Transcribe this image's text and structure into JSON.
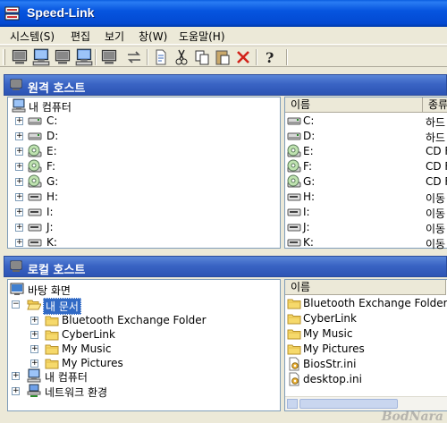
{
  "window": {
    "title": "Speed-Link"
  },
  "menu": [
    {
      "label": "시스템(S)"
    },
    {
      "label": "편집"
    },
    {
      "label": "보기"
    },
    {
      "label": "창(W)"
    },
    {
      "label": "도움말(H)"
    }
  ],
  "toolbar": {
    "buttons": [
      "connect-icon",
      "computer-icon",
      "computer-off-icon",
      "network-computer-icon",
      "disconnect-icon",
      "transfer-icon",
      "properties-icon",
      "cut-icon",
      "copy-icon",
      "paste-icon",
      "delete-icon",
      "help-icon"
    ]
  },
  "remote": {
    "header": "원격 호스트",
    "tree_root": "내 컴퓨터",
    "drives": [
      {
        "label": "C:",
        "kind": "hdd"
      },
      {
        "label": "D:",
        "kind": "hdd"
      },
      {
        "label": "E:",
        "kind": "cd"
      },
      {
        "label": "F:",
        "kind": "cd"
      },
      {
        "label": "G:",
        "kind": "cd"
      },
      {
        "label": "H:",
        "kind": "removable"
      },
      {
        "label": "I:",
        "kind": "removable"
      },
      {
        "label": "J:",
        "kind": "removable"
      },
      {
        "label": "K:",
        "kind": "removable"
      }
    ],
    "columns": {
      "name": "이름",
      "type": "종류"
    },
    "list": [
      {
        "name": "C:",
        "type": "하드",
        "kind": "hdd"
      },
      {
        "name": "D:",
        "type": "하드",
        "kind": "hdd"
      },
      {
        "name": "E:",
        "type": "CD F",
        "kind": "cd"
      },
      {
        "name": "F:",
        "type": "CD F",
        "kind": "cd"
      },
      {
        "name": "G:",
        "type": "CD F",
        "kind": "cd"
      },
      {
        "name": "H:",
        "type": "이동",
        "kind": "removable"
      },
      {
        "name": "I:",
        "type": "이동",
        "kind": "removable"
      },
      {
        "name": "J:",
        "type": "이동",
        "kind": "removable"
      },
      {
        "name": "K:",
        "type": "이동",
        "kind": "removable"
      }
    ]
  },
  "local": {
    "header": "로컬 호스트",
    "tree": {
      "desktop": "바탕 화면",
      "my_documents": "내 문서",
      "folders": [
        "Bluetooth Exchange Folder",
        "CyberLink",
        "My Music",
        "My Pictures"
      ],
      "my_computer": "내 컴퓨터",
      "network": "네트워크 환경"
    },
    "columns": {
      "name": "이름"
    },
    "list": [
      {
        "name": "Bluetooth Exchange Folder",
        "kind": "folder"
      },
      {
        "name": "CyberLink",
        "kind": "folder"
      },
      {
        "name": "My Music",
        "kind": "folder"
      },
      {
        "name": "My Pictures",
        "kind": "folder"
      },
      {
        "name": "BiosStr.ini",
        "kind": "ini"
      },
      {
        "name": "desktop.ini",
        "kind": "ini"
      }
    ]
  },
  "watermark": "BodNara"
}
